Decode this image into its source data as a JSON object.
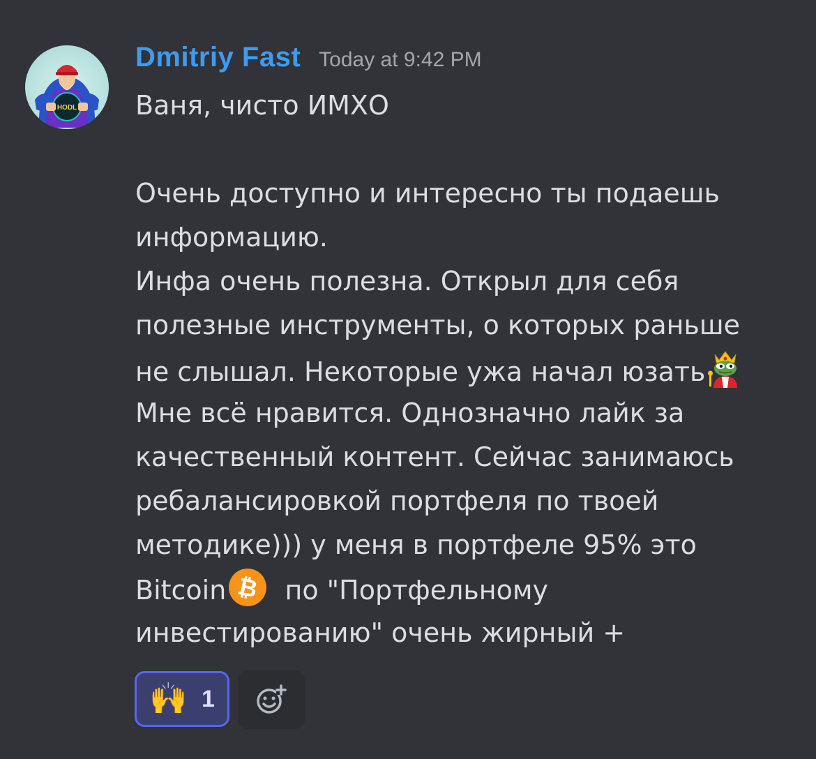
{
  "message": {
    "author": "Dmitriy Fast",
    "timestamp": "Today at 9:42 PM",
    "avatar_badge_text": "HODL",
    "lines": [
      "Ваня, чисто ИМХО",
      "",
      "Очень доступно и интересно ты подаешь",
      "информацию.",
      "Инфа очень полезна. Открыл для себя",
      "полезные инструменты, о которых раньше",
      "не слышал. Некоторые ужа начал юзать",
      "Мне всё нравится.  Однозначно лайк за",
      "качественный контент. Сейчас занимаюсь",
      "ребалансировкой портфеля по твоей",
      "методике))) у меня  в портфеле 95% это",
      "Bitcoin",
      "  по \"Портфельному",
      "инвестированию\" очень жирный +"
    ],
    "inline_emojis": {
      "pepe_king": "pepe-king-emoji",
      "bitcoin": "bitcoin-emoji"
    }
  },
  "reactions": [
    {
      "emoji": "🙌",
      "count": "1",
      "active": true
    }
  ],
  "add_reaction_icon": "add-reaction-icon",
  "colors": {
    "background": "#313338",
    "username": "#3d9bf0",
    "text": "#dbdee1",
    "timestamp": "#a3a6aa",
    "reaction_border": "#5865f2",
    "reaction_bg": "#3b3f6f",
    "bitcoin": "#f7931a"
  }
}
